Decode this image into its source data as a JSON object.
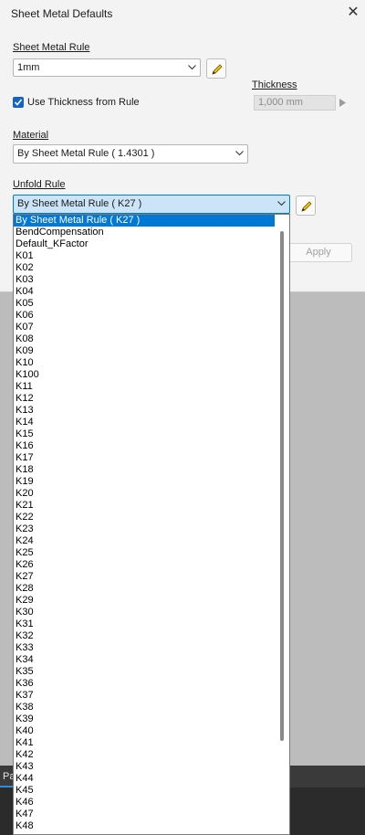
{
  "dialog": {
    "title": "Sheet Metal Defaults",
    "close_label": "✕"
  },
  "sheet_metal_rule": {
    "label": "Sheet Metal Rule",
    "value": "1mm"
  },
  "use_thickness": {
    "label": "Use Thickness from Rule",
    "checked": true
  },
  "thickness": {
    "label": "Thickness",
    "value": "1,000 mm"
  },
  "material": {
    "label": "Material",
    "value": "By Sheet Metal Rule ( 1.4301 )"
  },
  "unfold_rule": {
    "label": "Unfold Rule",
    "value": "By Sheet Metal Rule ( K27 )",
    "options": [
      "By Sheet Metal Rule ( K27 )",
      "BendCompensation",
      "Default_KFactor",
      "K01",
      "K02",
      "K03",
      "K04",
      "K05",
      "K06",
      "K07",
      "K08",
      "K09",
      "K10",
      "K100",
      "K11",
      "K12",
      "K13",
      "K14",
      "K15",
      "K16",
      "K17",
      "K18",
      "K19",
      "K20",
      "K21",
      "K22",
      "K23",
      "K24",
      "K25",
      "K26",
      "K27",
      "K28",
      "K29",
      "K30",
      "K31",
      "K32",
      "K33",
      "K34",
      "K35",
      "K36",
      "K37",
      "K38",
      "K39",
      "K40",
      "K41",
      "K42",
      "K43",
      "K44",
      "K45",
      "K46",
      "K47",
      "K48"
    ],
    "selected_index": 0
  },
  "buttons": {
    "apply": "Apply"
  },
  "background_tab": {
    "label": "Pa"
  },
  "colors": {
    "accent": "#0078d4",
    "checkbox": "#1565c0"
  }
}
